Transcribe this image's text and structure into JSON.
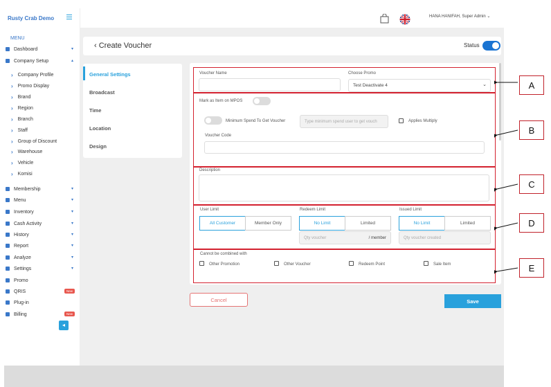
{
  "sidebar": {
    "brand": "Rusty Crab Demo",
    "menu_label": "MENU",
    "items": [
      {
        "label": "Dashboard",
        "icon": "dashboard-icon"
      },
      {
        "label": "Company Setup",
        "icon": "building-icon"
      },
      {
        "label": "Membership",
        "icon": "users-icon"
      },
      {
        "label": "Menu",
        "icon": "cutlery-icon"
      },
      {
        "label": "Inventory",
        "icon": "box-icon"
      },
      {
        "label": "Cash Activity",
        "icon": "dollar-icon"
      },
      {
        "label": "History",
        "icon": "history-icon"
      },
      {
        "label": "Report",
        "icon": "report-icon"
      },
      {
        "label": "Analyze",
        "icon": "pie-chart-icon"
      },
      {
        "label": "Settings",
        "icon": "gear-icon"
      },
      {
        "label": "Promo",
        "icon": "percent-icon"
      },
      {
        "label": "QRIS",
        "icon": "qr-icon",
        "badge": "New"
      },
      {
        "label": "Plug-in",
        "icon": "plug-icon"
      },
      {
        "label": "Billing",
        "icon": "bill-icon",
        "badge": "New"
      }
    ],
    "company_setup_sub": [
      "Company Profile",
      "Promo Display",
      "Brand",
      "Region",
      "Branch",
      "Staff",
      "Group of Discount",
      "Warehouse",
      "Vehicle",
      "Komisi"
    ]
  },
  "topbar": {
    "user": "HANA HANIFAH, Super Admin"
  },
  "header": {
    "title": "Create Voucher",
    "status_label": "Status"
  },
  "tabs": [
    "General Settings",
    "Broadcast",
    "Time",
    "Location",
    "Design"
  ],
  "form": {
    "voucher_name_label": "Voucher Name",
    "voucher_name_value": "",
    "choose_promo_label": "Choose Promo",
    "choose_promo_value": "Test Deactivate 4",
    "mark_mpos_label": "Mark as Item on MPOS",
    "min_spend_label": "Minimum Spend To Get Voucher",
    "min_spend_placeholder": "Type minimum spend user to get vouch",
    "applies_multiply_label": "Applies Multiply",
    "voucher_code_label": "Voucher Code",
    "description_label": "Description",
    "user_limit_label": "User Limit",
    "user_limit_options": [
      "All Customer",
      "Member Only"
    ],
    "redeem_limit_label": "Redeem Limit",
    "redeem_limit_options": [
      "No Limit",
      "Limited"
    ],
    "qty_voucher_placeholder": "Qty voucher",
    "per_member": "/ member",
    "issued_limit_label": "Issued Limit",
    "issued_limit_options": [
      "No Limit",
      "Limited"
    ],
    "qty_created_placeholder": "Qty voucher created",
    "cannot_combine_label": "Cannot be combined with",
    "combine_options": [
      "Other Promotion",
      "Other Voucher",
      "Redeem Point",
      "Sale Item"
    ]
  },
  "actions": {
    "cancel": "Cancel",
    "save": "Save"
  },
  "callouts": [
    "A",
    "B",
    "C",
    "D",
    "E"
  ],
  "colors": {
    "accent": "#29a1dc",
    "annotation_red": "#d3202e",
    "toggle_on": "#1a74d2",
    "cancel": "#e57373"
  }
}
